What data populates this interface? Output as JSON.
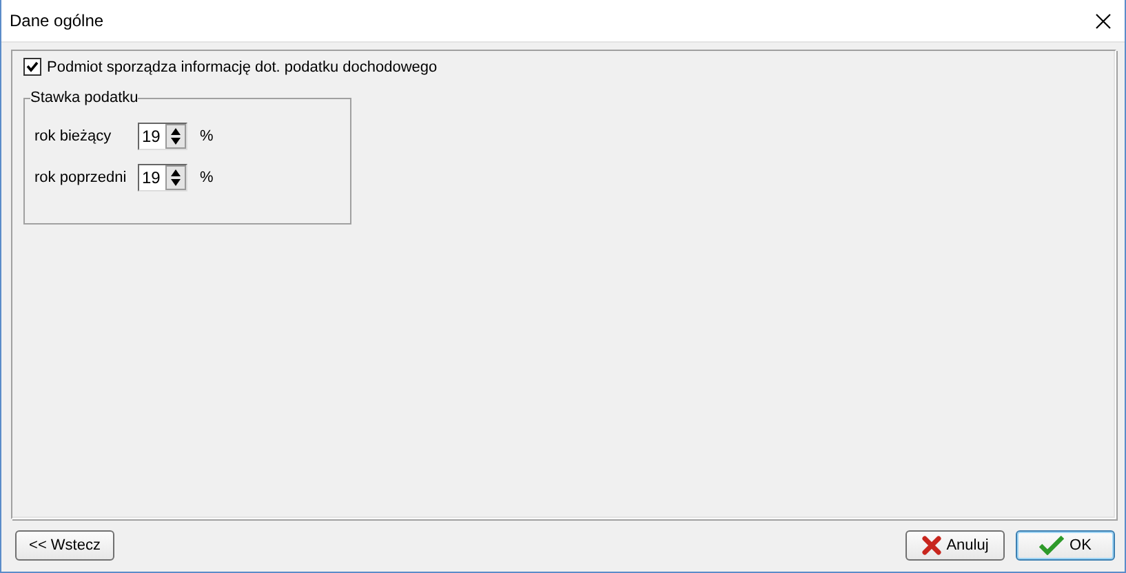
{
  "window": {
    "title": "Dane ogólne"
  },
  "checkbox": {
    "label": "Podmiot sporządza informację dot. podatku dochodowego",
    "checked": true
  },
  "group": {
    "title": "Stawka podatku",
    "rows": [
      {
        "label": "rok bieżący",
        "value": "19",
        "unit": "%"
      },
      {
        "label": "rok poprzedni",
        "value": "19",
        "unit": "%"
      }
    ]
  },
  "buttons": [
    {
      "kind": "back",
      "label": "<< Wstecz"
    },
    {
      "kind": "cancel",
      "label": "Anuluj"
    },
    {
      "kind": "ok",
      "label": "OK"
    }
  ]
}
